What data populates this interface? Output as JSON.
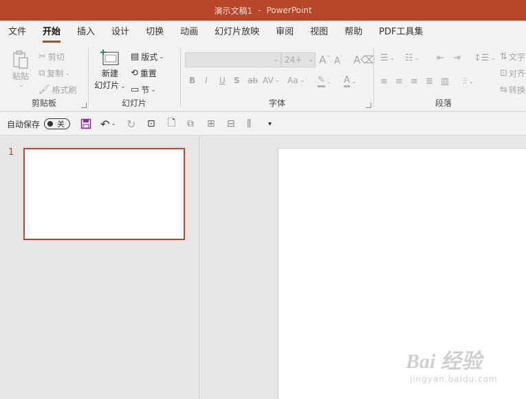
{
  "app": {
    "doc_title": "演示文稿1",
    "separator": "-",
    "app_name": "PowerPoint",
    "accent_color": "#b7472a"
  },
  "tabs": [
    {
      "label": "文件"
    },
    {
      "label": "开始",
      "active": true
    },
    {
      "label": "插入"
    },
    {
      "label": "设计"
    },
    {
      "label": "切换"
    },
    {
      "label": "动画"
    },
    {
      "label": "幻灯片放映"
    },
    {
      "label": "审阅"
    },
    {
      "label": "视图"
    },
    {
      "label": "帮助"
    },
    {
      "label": "PDF工具集"
    }
  ],
  "ribbon": {
    "clipboard": {
      "paste": "粘贴",
      "cut": "剪切",
      "copy": "复制",
      "format_painter": "格式刷",
      "label": "剪贴板"
    },
    "slides": {
      "new_slide_line1": "新建",
      "new_slide_line2": "幻灯片",
      "layout": "版式",
      "reset": "重置",
      "section": "节",
      "label": "幻灯片"
    },
    "font": {
      "font_name": "",
      "font_size": "24+",
      "label": "字体",
      "buttons": [
        "B",
        "I",
        "U",
        "S",
        "ab",
        "AV",
        "Aa"
      ]
    },
    "paragraph": {
      "label": "段落",
      "text_direction": "文字",
      "align_text": "对齐",
      "convert": "转换"
    }
  },
  "qat": {
    "autosave": "自动保存",
    "autosave_state": "关"
  },
  "slides_pane": {
    "slide_number": "1"
  },
  "watermark": {
    "line1": "Bai  经验",
    "line2": "jingyan.baidu.com"
  }
}
